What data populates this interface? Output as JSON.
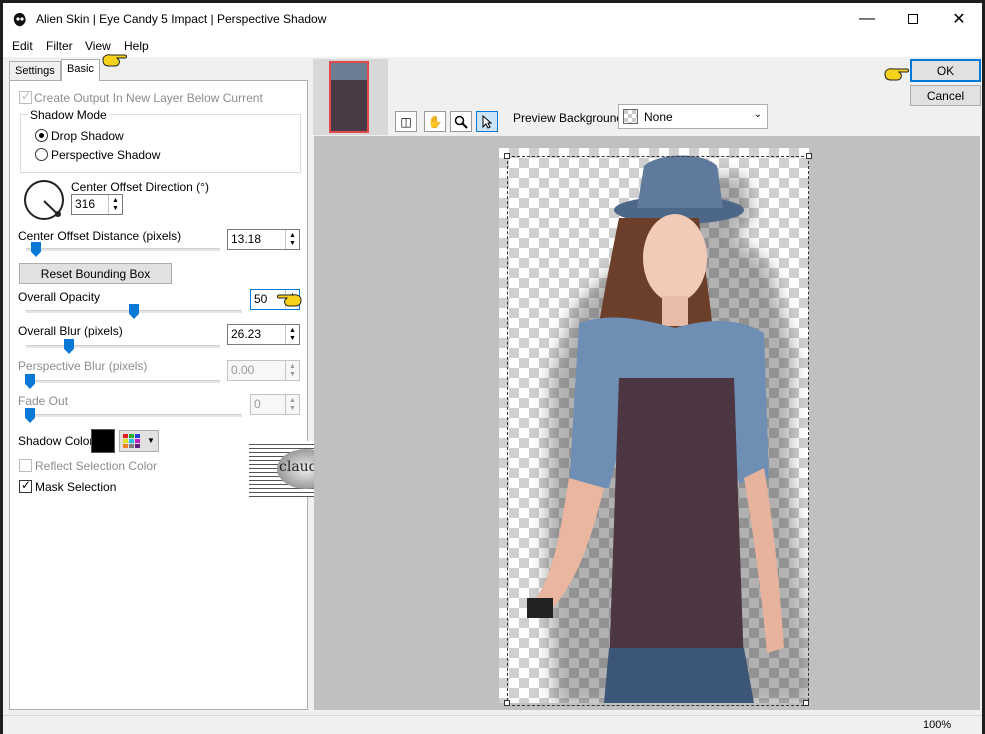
{
  "window": {
    "title": "Alien Skin | Eye Candy 5 Impact | Perspective Shadow"
  },
  "menu": [
    "Edit",
    "Filter",
    "View",
    "Help"
  ],
  "tabs": [
    "Settings",
    "Basic"
  ],
  "basic": {
    "create_output_label": "Create Output In New Layer Below Current",
    "shadow_mode_label": "Shadow Mode",
    "drop_shadow_label": "Drop Shadow",
    "perspective_shadow_label": "Perspective Shadow",
    "center_offset_direction_label": "Center Offset Direction (°)",
    "center_offset_direction_value": "316",
    "center_offset_distance_label": "Center Offset Distance (pixels)",
    "center_offset_distance_value": "13.18",
    "reset_bounding_box_label": "Reset Bounding Box",
    "overall_opacity_label": "Overall Opacity",
    "overall_opacity_value": "50",
    "overall_blur_label": "Overall Blur (pixels)",
    "overall_blur_value": "26.23",
    "perspective_blur_label": "Perspective Blur (pixels)",
    "perspective_blur_value": "0.00",
    "fade_out_label": "Fade Out",
    "fade_out_value": "0",
    "shadow_color_label": "Shadow Color",
    "reflect_selection_color_label": "Reflect Selection Color",
    "mask_selection_label": "Mask Selection"
  },
  "buttons": {
    "ok": "OK",
    "cancel": "Cancel"
  },
  "preview_background": {
    "label": "Preview Background:",
    "value": "None"
  },
  "status": {
    "zoom": "100%"
  },
  "watermark": "claudia",
  "colors": {
    "accent": "#0078d7",
    "shadow_color": "#000000",
    "slider_thumb": "#0a78d7"
  }
}
